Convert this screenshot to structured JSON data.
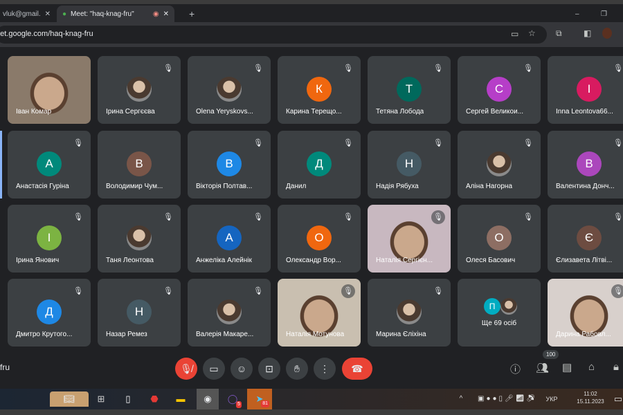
{
  "browser": {
    "tabs": [
      {
        "label": "vluk@gmail.",
        "active": false
      },
      {
        "label": "Meet: \"haq-knag-fru\"",
        "active": true
      }
    ],
    "url": "eet.google.com/haq-knag-fru",
    "new_tab": "+",
    "minimize": "–",
    "restore": "❐"
  },
  "participants": [
    {
      "name": "Іван Комар",
      "type": "video",
      "bg": "#8a7a6a"
    },
    {
      "name": "Ірина Сергєєва",
      "type": "photo",
      "muted": true
    },
    {
      "name": "Olena Yeryskovs...",
      "type": "photo",
      "muted": true
    },
    {
      "name": "Карина Терещо...",
      "initial": "К",
      "color": "#f0670f",
      "muted": true
    },
    {
      "name": "Тетяна Лобода",
      "initial": "Т",
      "color": "#00695c",
      "muted": true
    },
    {
      "name": "Сергей Великои...",
      "initial": "С",
      "color": "#b63ec8",
      "muted": true
    },
    {
      "name": "Inna Leontova66...",
      "initial": "I",
      "color": "#d81b60",
      "muted": true
    },
    {
      "name": "Анастасія Гуріна",
      "initial": "А",
      "color": "#00897b",
      "muted": true
    },
    {
      "name": "Володимир Чум...",
      "initial": "В",
      "color": "#795548",
      "muted": false
    },
    {
      "name": "Вікторія Полтав...",
      "initial": "В",
      "color": "#1e88e5",
      "muted": true
    },
    {
      "name": "Данил",
      "initial": "Д",
      "color": "#00897b",
      "muted": true
    },
    {
      "name": "Надія Рябуха",
      "initial": "Н",
      "color": "#455a64",
      "muted": true
    },
    {
      "name": "Аліна Нагорна",
      "type": "photo",
      "muted": true
    },
    {
      "name": "Валентина Донч...",
      "initial": "В",
      "color": "#ab47bc",
      "muted": true
    },
    {
      "name": "Ірина Янович",
      "initial": "І",
      "color": "#7cb342",
      "muted": true
    },
    {
      "name": "Таня Леонтова",
      "type": "photo",
      "muted": true
    },
    {
      "name": "Анжеліка Алейнік",
      "initial": "А",
      "color": "#1565c0",
      "muted": true
    },
    {
      "name": "Олександр Вор...",
      "initial": "О",
      "color": "#f0670f",
      "muted": true
    },
    {
      "name": "Наталія Сергієн...",
      "type": "video",
      "bg": "#c8b8c0",
      "muted": true
    },
    {
      "name": "Олеся Басович",
      "initial": "О",
      "color": "#8d6e63",
      "muted": true
    },
    {
      "name": "Єлизавета Літві...",
      "initial": "Є",
      "color": "#6d4c41",
      "muted": true
    },
    {
      "name": "Дмитро Крутого...",
      "initial": "Д",
      "color": "#1e88e5",
      "muted": true
    },
    {
      "name": "Назар Ремез",
      "initial": "Н",
      "color": "#455a64",
      "muted": true
    },
    {
      "name": "Валерія Макаре...",
      "type": "photo",
      "muted": true
    },
    {
      "name": "Наталія Мотунова",
      "type": "video",
      "bg": "#c9bfb0",
      "muted": true
    },
    {
      "name": "Марина Єліхіна",
      "type": "photo",
      "muted": true
    },
    {
      "name": "Ще 69 осіб",
      "type": "more",
      "initial": "П",
      "color": "#00acc1"
    },
    {
      "name": "Дарина Рабовл...",
      "type": "video",
      "bg": "#d8d0cc",
      "muted": true
    }
  ],
  "footer": {
    "meeting_code": "fru",
    "participants_badge": "100"
  },
  "taskbar": {
    "viber_badge": "5",
    "telegram_badge": "81",
    "lang": "УКР",
    "time": "11:02",
    "date": "15.11.2023"
  },
  "colors": {
    "end_call": "#ea4335",
    "tile": "#3c4043",
    "bg": "#202124"
  }
}
